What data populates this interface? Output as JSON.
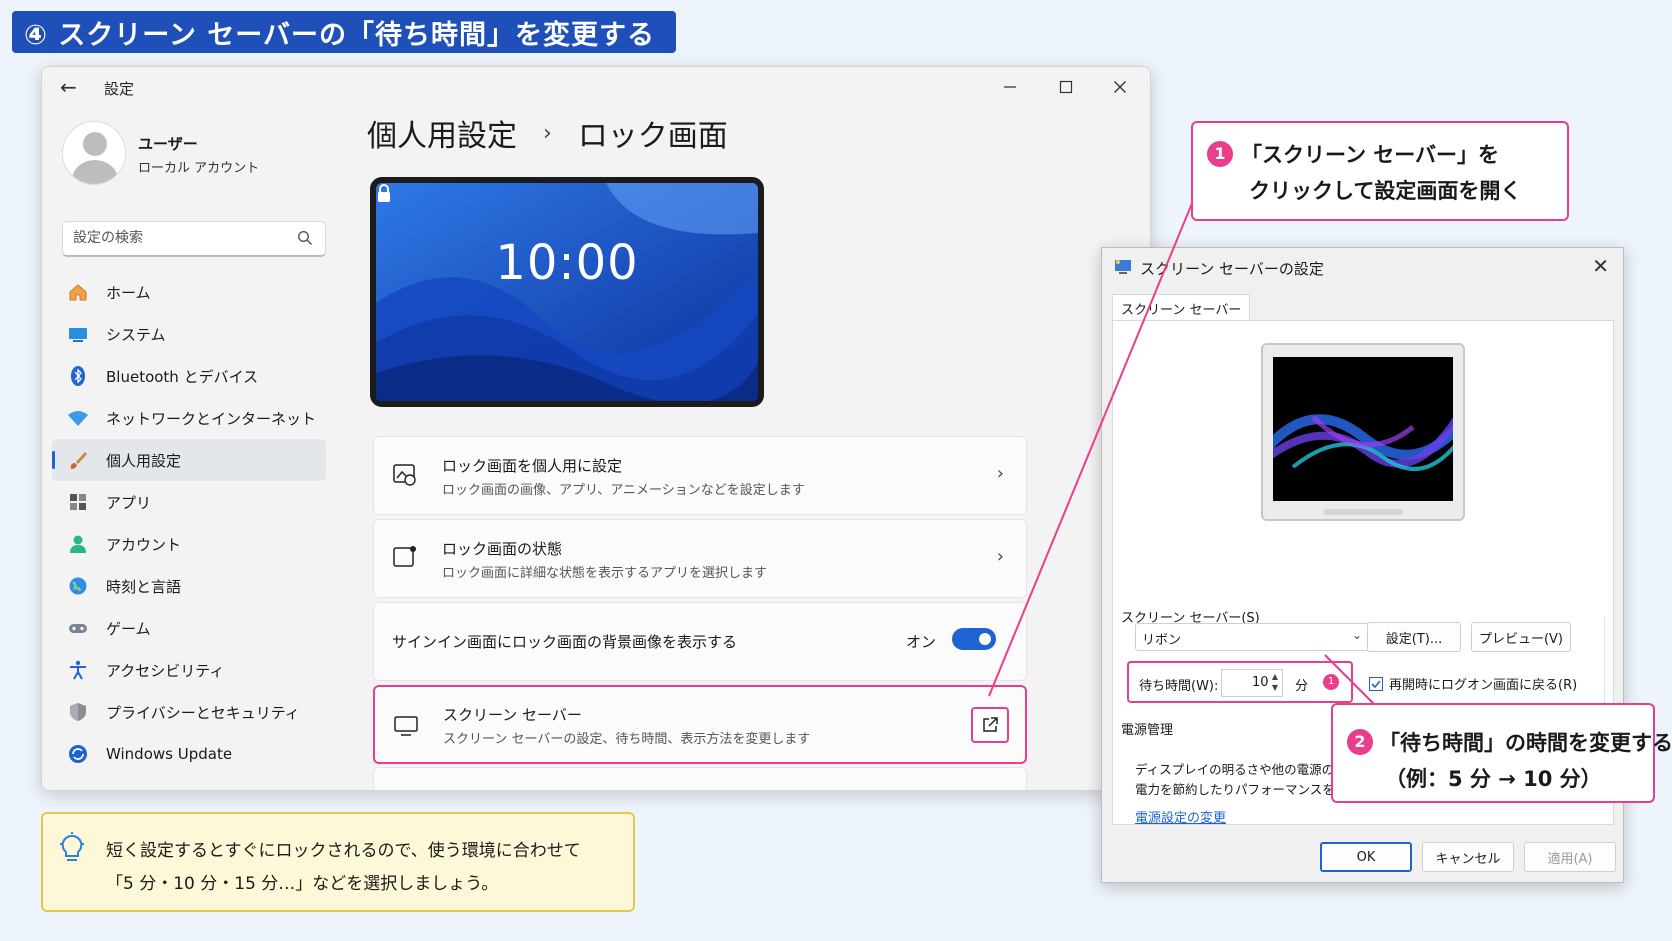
{
  "banner": {
    "title": "④ スクリーン セーバーの「待ち時間」を変更する"
  },
  "settings": {
    "window_title": "設定",
    "user": {
      "name": "ユーザー",
      "account_type": "ローカル アカウント"
    },
    "search": {
      "placeholder": "設定の検索"
    },
    "nav": [
      {
        "label": "ホーム",
        "icon": "home-icon"
      },
      {
        "label": "システム",
        "icon": "system-icon"
      },
      {
        "label": "Bluetooth とデバイス",
        "icon": "bluetooth-icon"
      },
      {
        "label": "ネットワークとインターネット",
        "icon": "network-icon"
      },
      {
        "label": "個人用設定",
        "icon": "brush-icon",
        "active": true
      },
      {
        "label": "アプリ",
        "icon": "apps-icon"
      },
      {
        "label": "アカウント",
        "icon": "account-icon"
      },
      {
        "label": "時刻と言語",
        "icon": "globe-icon"
      },
      {
        "label": "ゲーム",
        "icon": "gamepad-icon"
      },
      {
        "label": "アクセシビリティ",
        "icon": "accessibility-icon"
      },
      {
        "label": "プライバシーとセキュリティ",
        "icon": "shield-icon"
      },
      {
        "label": "Windows Update",
        "icon": "update-icon"
      }
    ],
    "breadcrumb": {
      "parent": "個人用設定",
      "separator": "›",
      "current": "ロック画面"
    },
    "lock_preview": {
      "time": "10:00"
    },
    "cards": {
      "personalize": {
        "title": "ロック画面を個人用に設定",
        "desc": "ロック画面の画像、アプリ、アニメーションなどを設定します"
      },
      "status": {
        "title": "ロック画面の状態",
        "desc": "ロック画面に詳細な状態を表示するアプリを選択します"
      },
      "signin_bg": {
        "title": "サインイン画面にロック画面の背景画像を表示する",
        "toggle_label": "オン",
        "toggle_on": true
      },
      "screensaver": {
        "title": "スクリーン セーバー",
        "desc": "スクリーン セーバーの設定、待ち時間、表示方法を変更します"
      }
    }
  },
  "tip": {
    "line1": "短く設定するとすぐにロックされるので、使う環境に合わせて",
    "line2": "「5 分・10 分・15 分…」などを選択しましょう。"
  },
  "dialog": {
    "title": "スクリーン セーバーの設定",
    "tab": "スクリーン セーバー",
    "group_label": "スクリーン セーバー(S)",
    "selected_saver": "リボン",
    "settings_button": "設定(T)...",
    "preview_button": "プレビュー(V)",
    "wait_label": "待ち時間(W):",
    "wait_value": "10",
    "wait_unit": "分",
    "resume_checkbox": "再開時にログオン画面に戻る(R)",
    "resume_checked": true,
    "power_label": "電源管理",
    "power_text1": "ディスプレイの明るさや他の電源の設",
    "power_text2": "電力を節約したりパフォーマンスを最",
    "power_link": "電源設定の変更",
    "ok": "OK",
    "cancel": "キャンセル",
    "apply": "適用(A)"
  },
  "callouts": {
    "step1": {
      "num": "1",
      "line1": "「スクリーン セーバー」を",
      "line2": "クリックして設定画面を開く"
    },
    "step2": {
      "num": "2",
      "line1": "「待ち時間」の時間を変更する",
      "line2": "（例：5 分 → 10 分）"
    },
    "mini": "1"
  },
  "colors": {
    "accent": "#1f62d3",
    "banner": "#1f4fb8",
    "highlight": "#e83e8c",
    "tip_bg": "#fdf8d8"
  }
}
